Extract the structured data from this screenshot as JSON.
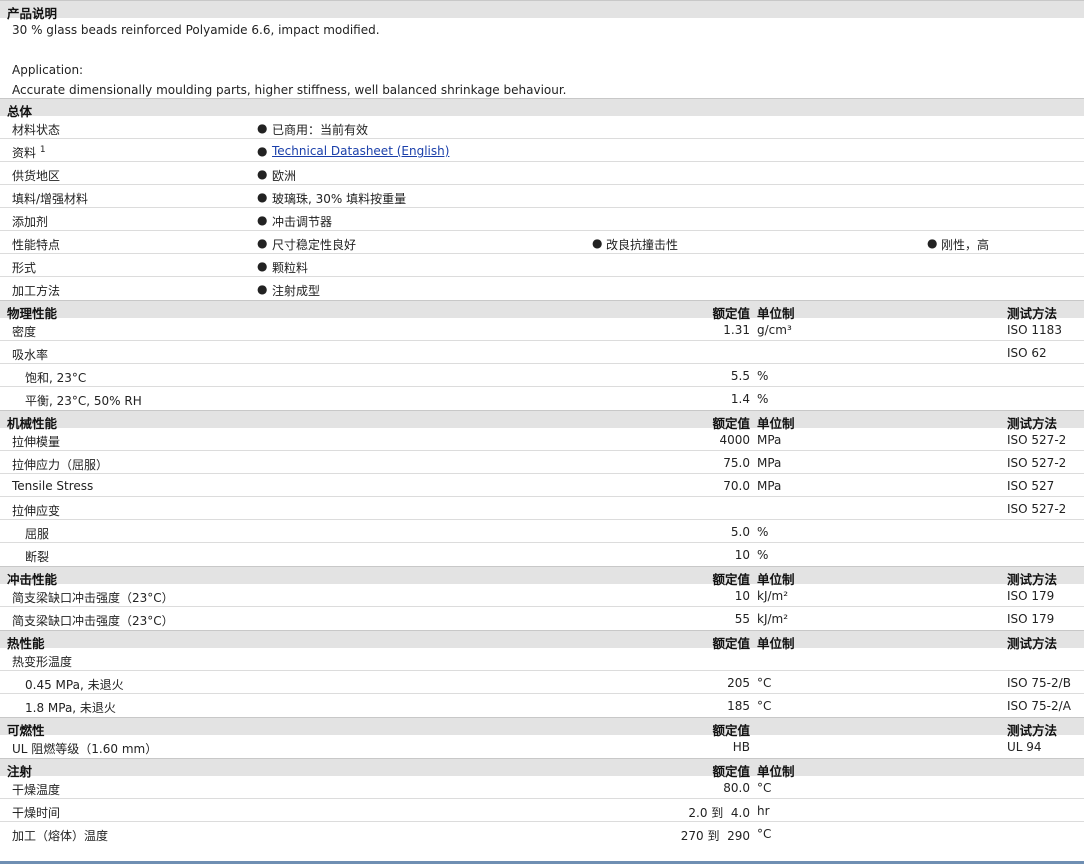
{
  "product_description": {
    "title": "产品说明",
    "line1": "30 % glass beads reinforced Polyamide 6.6, impact modified.",
    "line2": "Application:",
    "line3": "Accurate dimensionally moulding parts, higher stiffness, well balanced shrinkage behaviour."
  },
  "general": {
    "title": "总体",
    "rows": [
      {
        "label": "材料状态",
        "value": "已商用：当前有效"
      },
      {
        "label": "资料",
        "sup": "1",
        "value": "Technical Datasheet (English)"
      },
      {
        "label": "供货地区",
        "value": "欧洲"
      },
      {
        "label": "填料/增强材料",
        "value": "玻璃珠, 30% 填料按重量"
      },
      {
        "label": "添加剂",
        "value": "冲击调节器"
      },
      {
        "label": "性能特点",
        "values": [
          "尺寸稳定性良好",
          "改良抗撞击性",
          "刚性，高"
        ]
      },
      {
        "label": "形式",
        "value": "颗粒料"
      },
      {
        "label": "加工方法",
        "value": "注射成型"
      }
    ]
  },
  "bullet": "●",
  "physical": {
    "title": "物理性能",
    "col_value": "额定值",
    "col_unit": "单位制",
    "col_method": "测试方法",
    "rows": [
      {
        "label": "密度",
        "value": "1.31",
        "unit": "g/cm³",
        "method": "ISO 1183"
      },
      {
        "label": "吸水率",
        "value": "",
        "unit": "",
        "method": "ISO 62"
      },
      {
        "label": "饱和, 23°C",
        "value": "5.5",
        "unit": "%",
        "method": ""
      },
      {
        "label": "平衡, 23°C, 50% RH",
        "value": "1.4",
        "unit": "%",
        "method": ""
      }
    ]
  },
  "mechanical": {
    "title": "机械性能",
    "col_value": "额定值",
    "col_unit": "单位制",
    "col_method": "测试方法",
    "rows": [
      {
        "label": "拉伸模量",
        "value": "4000",
        "unit": "MPa",
        "method": "ISO 527-2"
      },
      {
        "label": "拉伸应力（屈服）",
        "value": "75.0",
        "unit": "MPa",
        "method": "ISO 527-2"
      },
      {
        "label": "Tensile Stress",
        "value": "70.0",
        "unit": "MPa",
        "method": "ISO 527"
      },
      {
        "label": "拉伸应变",
        "value": "",
        "unit": "",
        "method": "ISO 527-2"
      },
      {
        "label": "屈服",
        "value": "5.0",
        "unit": "%",
        "method": ""
      },
      {
        "label": "断裂",
        "value": "10",
        "unit": "%",
        "method": ""
      }
    ]
  },
  "impact": {
    "title": "冲击性能",
    "col_value": "额定值",
    "col_unit": "单位制",
    "col_method": "测试方法",
    "rows": [
      {
        "label": "简支梁缺口冲击强度（23°C）",
        "value": "10",
        "unit": "kJ/m²",
        "method": "ISO 179"
      },
      {
        "label": "简支梁缺口冲击强度（23°C）",
        "value": "55",
        "unit": "kJ/m²",
        "method": "ISO 179"
      }
    ]
  },
  "thermal": {
    "title": "热性能",
    "col_value": "额定值",
    "col_unit": "单位制",
    "col_method": "测试方法",
    "rows": [
      {
        "label": "热变形温度",
        "value": "",
        "unit": "",
        "method": ""
      },
      {
        "label": "0.45 MPa, 未退火",
        "value": "205",
        "unit": "°C",
        "method": "ISO 75-2/B"
      },
      {
        "label": "1.8 MPa, 未退火",
        "value": "185",
        "unit": "°C",
        "method": "ISO 75-2/A"
      }
    ]
  },
  "flammability": {
    "title": "可燃性",
    "col_value": "额定值",
    "col_method": "测试方法",
    "rows": [
      {
        "label": "UL 阻燃等级（1.60 mm）",
        "value": "HB",
        "method": "UL 94"
      }
    ]
  },
  "injection": {
    "title": "注射",
    "col_value": "额定值",
    "col_unit": "单位制",
    "rows": [
      {
        "label": "干燥温度",
        "value": "80.0",
        "unit": "°C"
      },
      {
        "label": "干燥时间",
        "value": "2.0 到  4.0",
        "unit": "hr"
      },
      {
        "label": "加工（熔体）温度",
        "value": "270 到  290",
        "unit": "°C"
      }
    ]
  }
}
